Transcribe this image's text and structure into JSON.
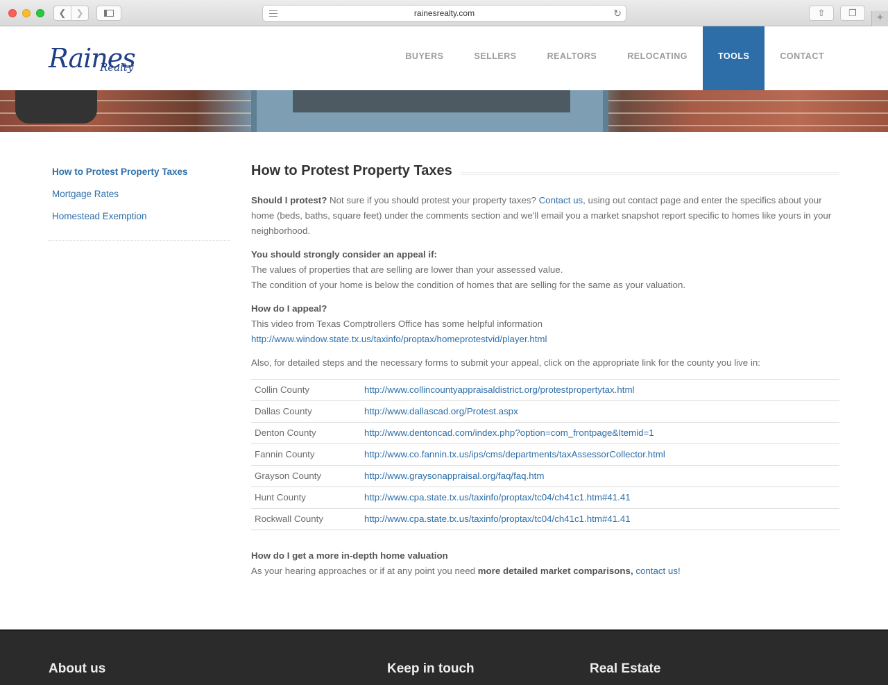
{
  "browser": {
    "url": "rainesrealty.com",
    "reload_icon": "reload-icon",
    "new_tab_icon": "plus-icon"
  },
  "logo": {
    "main": "Raines",
    "sub": "Realty"
  },
  "nav": {
    "items": [
      {
        "label": "BUYERS",
        "active": false
      },
      {
        "label": "SELLERS",
        "active": false
      },
      {
        "label": "REALTORS",
        "active": false
      },
      {
        "label": "RELOCATING",
        "active": false
      },
      {
        "label": "TOOLS",
        "active": true
      },
      {
        "label": "CONTACT",
        "active": false
      }
    ],
    "active_color": "#2d6ea8"
  },
  "sidebar": {
    "items": [
      {
        "label": "How to Protest Property Taxes"
      },
      {
        "label": "Mortgage Rates"
      },
      {
        "label": "Homestead Exemption"
      }
    ]
  },
  "main": {
    "title": "How to Protest Property Taxes",
    "protest": {
      "lead": "Should I protest?",
      "text1": " Not sure if you should protest your property taxes? ",
      "link": "Contact us",
      "text2": ", using out contact page and enter the specifics about your home (beds, baths, square feet) under the comments section and we'll email you a market snapshot report specific to homes like yours in your neighborhood."
    },
    "appeal": {
      "lead": "You should strongly consider an appeal if:",
      "line1": "The values of properties that are selling are lower than your assessed value.",
      "line2": "The condition of your home is below the condition of homes that are selling for the same as your valuation."
    },
    "how": {
      "lead": "How do I appeal?",
      "line": "This video from Texas Comptrollers Office has some helpful information",
      "link": "http://www.window.state.tx.us/taxinfo/proptax/homeprotestvid/player.html"
    },
    "also": "Also, for detailed steps and the necessary forms to submit your appeal, click on the appropriate link for the county you live in:",
    "counties": [
      {
        "county": "Collin County",
        "url": "http://www.collincountyappraisaldistrict.org/protestpropertytax.html"
      },
      {
        "county": "Dallas County",
        "url": "http://www.dallascad.org/Protest.aspx"
      },
      {
        "county": "Denton County",
        "url": "http://www.dentoncad.com/index.php?option=com_frontpage&Itemid=1"
      },
      {
        "county": "Fannin County",
        "url": "http://www.co.fannin.tx.us/ips/cms/departments/taxAssessorCollector.html"
      },
      {
        "county": "Grayson County",
        "url": "http://www.graysonappraisal.org/faq/faq.htm"
      },
      {
        "county": "Hunt County",
        "url": "http://www.cpa.state.tx.us/taxinfo/proptax/tc04/ch41c1.htm#41.41"
      },
      {
        "county": "Rockwall County",
        "url": "http://www.cpa.state.tx.us/taxinfo/proptax/tc04/ch41c1.htm#41.41"
      }
    ],
    "valuation": {
      "lead": "How do I get a more in-depth home valuation",
      "text1": "As your hearing approaches or if at any point you need ",
      "bold": "more detailed market comparisons,",
      "space": " ",
      "link": "contact us!"
    }
  },
  "footer": {
    "about": "About us",
    "keep": "Keep in touch",
    "realestate": "Real Estate"
  }
}
